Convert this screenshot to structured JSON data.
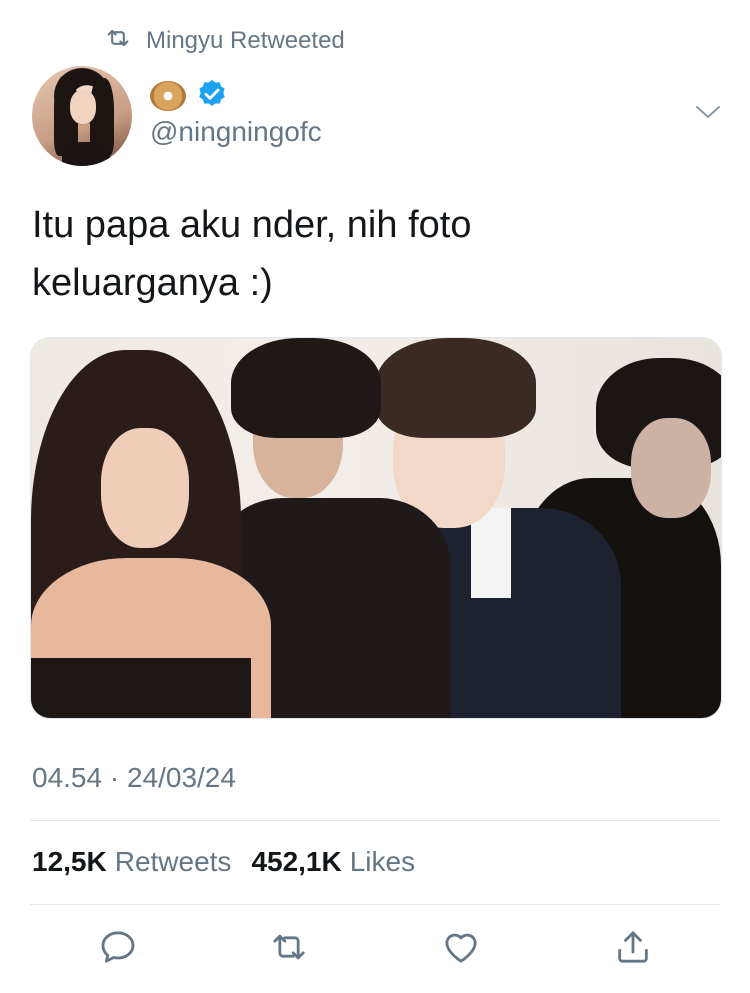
{
  "retweet_context": {
    "label": "Mingyu Retweeted",
    "icon": "retweet-icon"
  },
  "author": {
    "display_name_emoji": "bagel-emoji",
    "verified": true,
    "handle": "@ningningofc"
  },
  "tweet": {
    "text_line1": "Itu papa aku nder, nih foto",
    "text_line2": "keluarganya :)"
  },
  "timestamp": "04.54 · 24/03/24",
  "stats": {
    "retweets_count": "12,5K",
    "retweets_label": "Retweets",
    "likes_count": "452,1K",
    "likes_label": "Likes"
  },
  "actions": [
    "reply-icon",
    "retweet-icon",
    "like-icon",
    "share-icon"
  ],
  "colors": {
    "muted": "#657786",
    "text": "#14171a",
    "verified": "#1da1f2",
    "divider": "#e1e8ed"
  }
}
